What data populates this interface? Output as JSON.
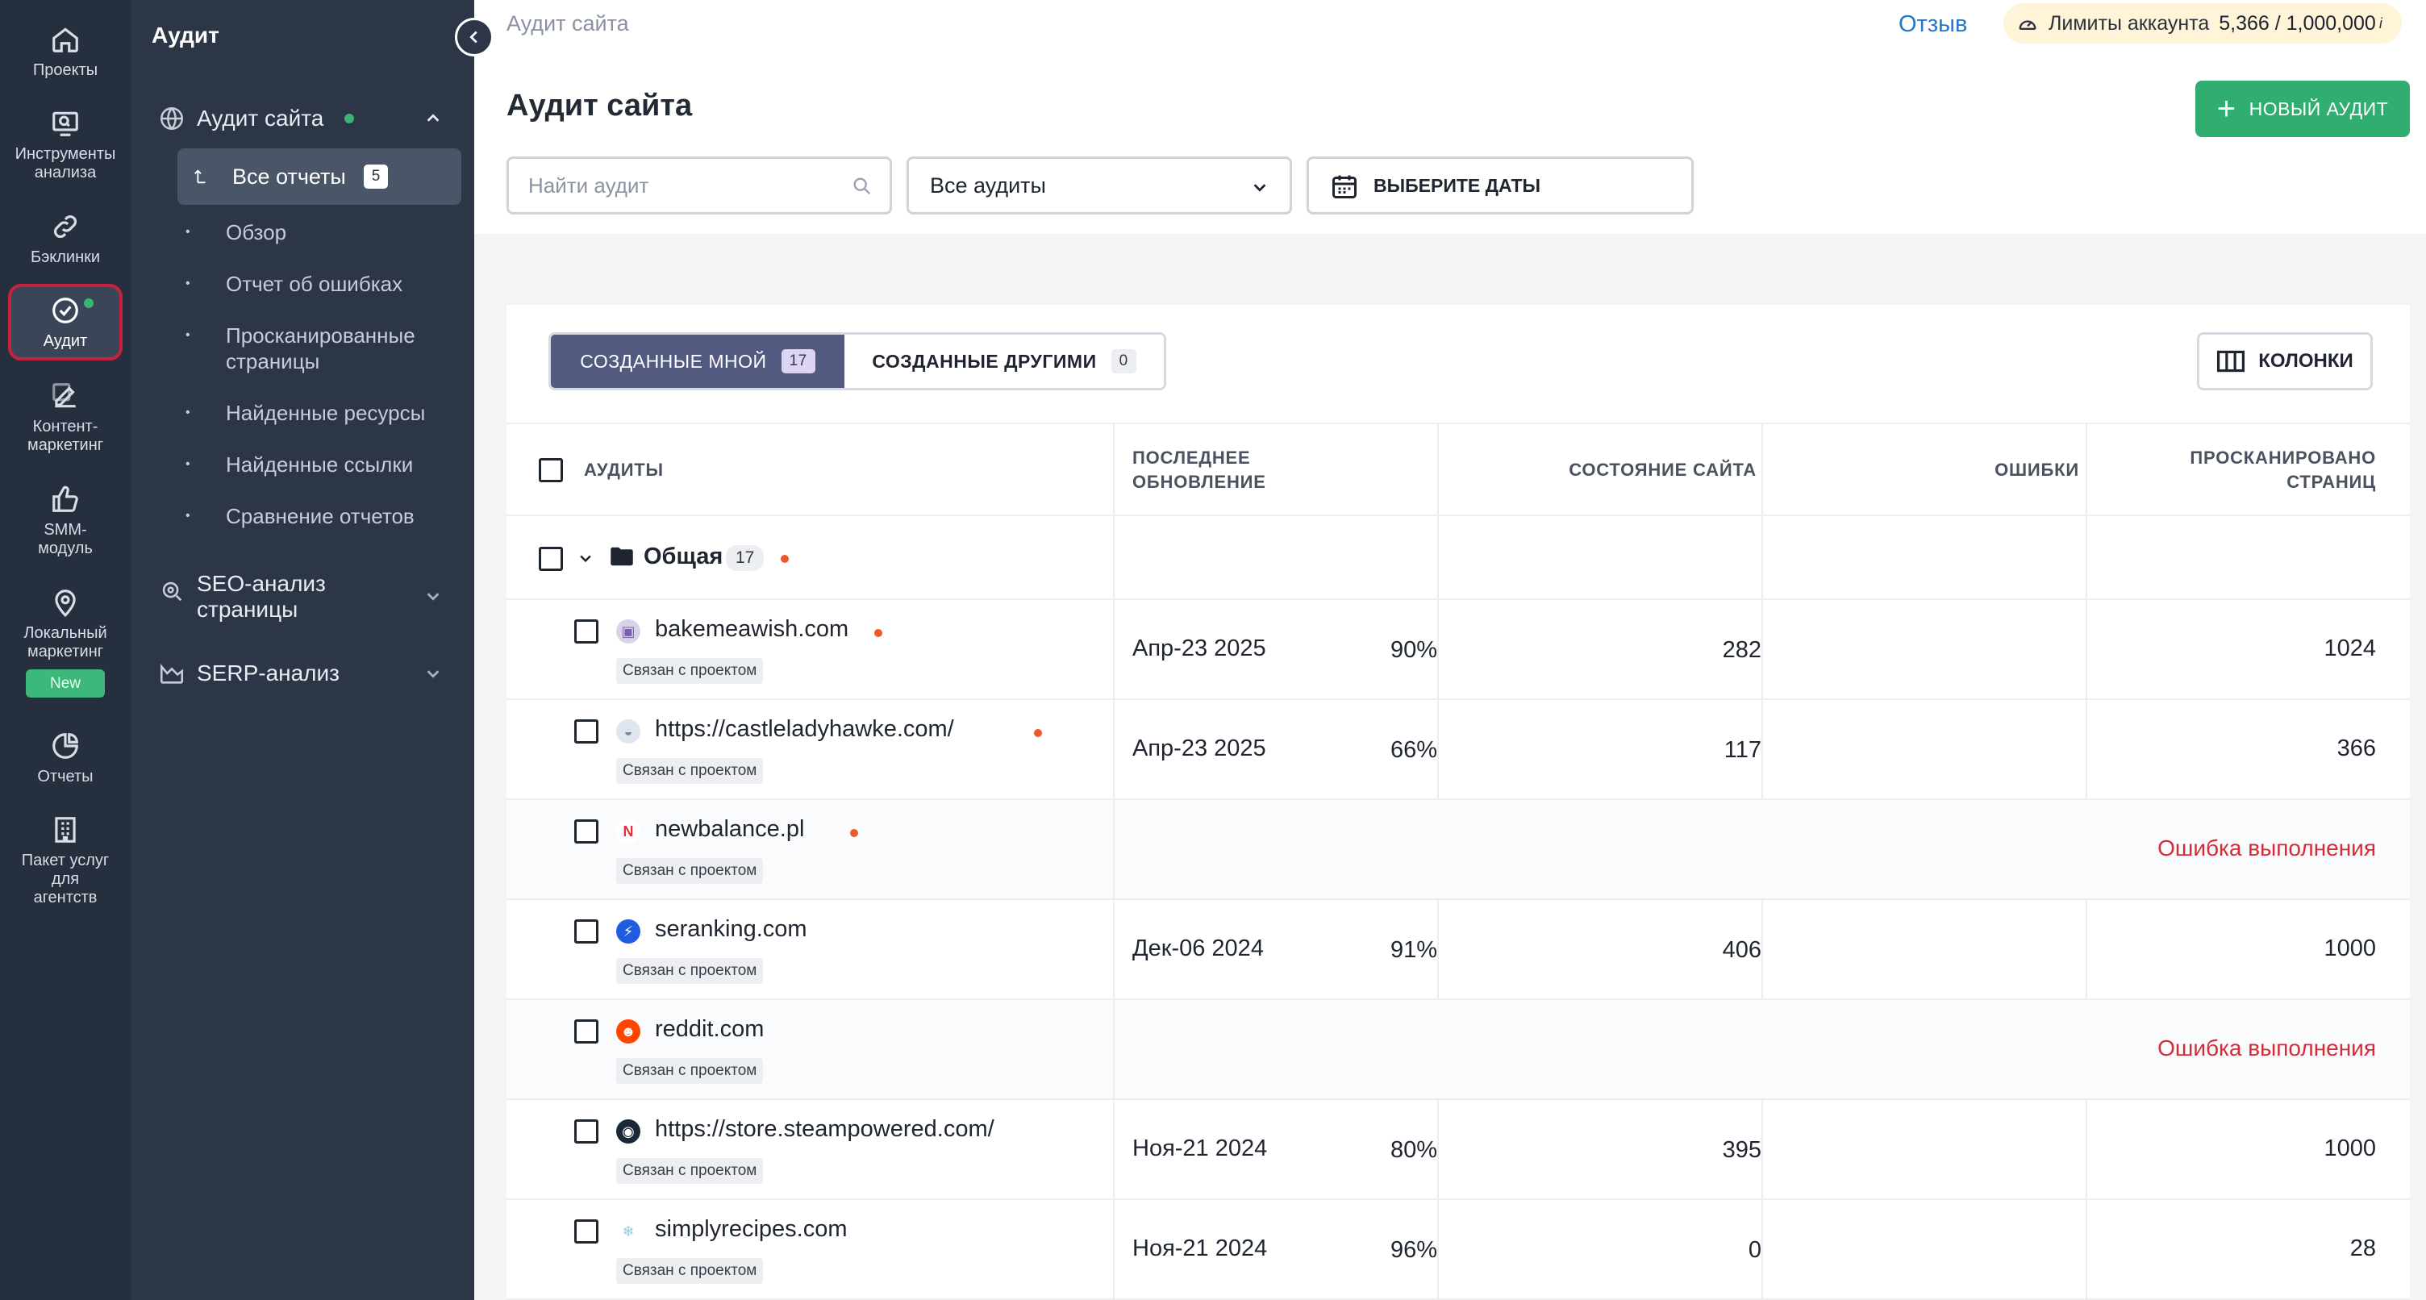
{
  "rail": {
    "items": [
      {
        "label": "Проекты",
        "icon": "home-icon"
      },
      {
        "label": "Инструменты анализа",
        "icon": "monitor-search-icon"
      },
      {
        "label": "Бэклинки",
        "icon": "link-icon"
      },
      {
        "label": "Аудит",
        "icon": "check-circle-icon"
      },
      {
        "label": "Контент-маркетинг",
        "icon": "edit-icon"
      },
      {
        "label": "SMM-модуль",
        "icon": "thumbs-up-icon"
      },
      {
        "label": "Локальный маркетинг",
        "icon": "location-pin-icon",
        "badge": "New"
      },
      {
        "label": "Отчеты",
        "icon": "pie-chart-icon"
      },
      {
        "label": "Пакет услуг для агентств",
        "icon": "building-icon"
      }
    ]
  },
  "sidebar": {
    "title": "Аудит",
    "site_audit": "Аудит сайта",
    "all_reports": "Все отчеты",
    "all_reports_count": "5",
    "subitems": [
      "Обзор",
      "Отчет об ошибках",
      "Просканированные страницы",
      "Найденные ресурсы",
      "Найденные ссылки",
      "Сравнение отчетов"
    ],
    "seo_page": "SEO-анализ страницы",
    "serp": "SERP-анализ"
  },
  "header": {
    "breadcrumb": "Аудит сайта",
    "feedback": "Отзыв",
    "limits_label": "Лимиты аккаунта",
    "limits_value": "5,366 / 1,000,000",
    "limits_info": "i",
    "title": "Аудит сайта",
    "new_audit": "НОВЫЙ АУДИТ"
  },
  "filters": {
    "search_placeholder": "Найти аудит",
    "select_value": "Все аудиты",
    "dates": "ВЫБЕРИТЕ ДАТЫ"
  },
  "tabs": {
    "mine": "СОЗДАННЫЕ МНОЙ",
    "mine_count": "17",
    "others": "СОЗДАННЫЕ ДРУГИМИ",
    "others_count": "0",
    "columns": "КОЛОНКИ"
  },
  "table": {
    "headers": {
      "audits": "АУДИТЫ",
      "updated_1": "ПОСЛЕДНЕЕ",
      "updated_2": "ОБНОВЛЕНИЕ",
      "health": "СОСТОЯНИЕ САЙТА",
      "errors": "ОШИБКИ",
      "crawled_1": "ПРОСКАНИРОВАНО",
      "crawled_2": "СТРАНИЦ"
    },
    "group": {
      "name": "Общая",
      "count": "17"
    },
    "linked_label": "Связан с проектом",
    "rows": [
      {
        "site": "bakemeawish.com",
        "date": "Апр-23 2025",
        "health": "90%",
        "errors": "282",
        "pages": "1024",
        "dot": true
      },
      {
        "site": "https://castleladyhawke.com/",
        "date": "Апр-23 2025",
        "health": "66%",
        "errors": "117",
        "pages": "366",
        "dot": true
      },
      {
        "site": "newbalance.pl",
        "error": "Ошибка выполнения",
        "dot": true
      },
      {
        "site": "seranking.com",
        "date": "Дек-06 2024",
        "health": "91%",
        "errors": "406",
        "pages": "1000"
      },
      {
        "site": "reddit.com",
        "error": "Ошибка выполнения"
      },
      {
        "site": "https://store.steampowered.com/",
        "date": "Ноя-21 2024",
        "health": "80%",
        "errors": "395",
        "pages": "1000"
      },
      {
        "site": "simplyrecipes.com",
        "date": "Ноя-21 2024",
        "health": "96%",
        "errors": "0",
        "pages": "28"
      }
    ]
  },
  "colors": {
    "rail": "#262f3d",
    "sidebar": "#2c3646",
    "accent_green": "#2fae6f",
    "tab_active": "#525a80",
    "error_red": "#d62a36",
    "link_blue": "#2477c9"
  }
}
